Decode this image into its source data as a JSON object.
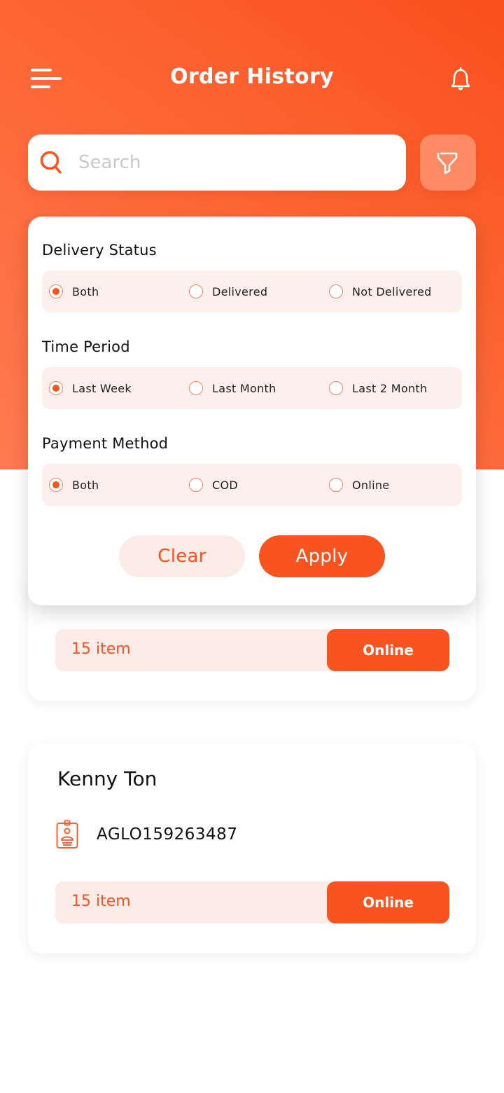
{
  "header": {
    "title": "Order History",
    "menu_icon": "hamburger-menu-icon",
    "notification_icon": "bell-icon"
  },
  "search": {
    "placeholder": "Search",
    "value": "",
    "icon": "search-icon",
    "filter_icon": "filter-funnel-icon"
  },
  "filter_panel": {
    "sections": [
      {
        "title": "Delivery Status",
        "options": [
          {
            "label": "Both",
            "selected": true
          },
          {
            "label": "Delivered",
            "selected": false
          },
          {
            "label": "Not Delivered",
            "selected": false
          }
        ]
      },
      {
        "title": "Time Period",
        "options": [
          {
            "label": "Last Week",
            "selected": true
          },
          {
            "label": "Last Month",
            "selected": false
          },
          {
            "label": "Last 2 Month",
            "selected": false
          }
        ]
      },
      {
        "title": "Payment Method",
        "options": [
          {
            "label": "Both",
            "selected": true
          },
          {
            "label": "COD",
            "selected": false
          },
          {
            "label": "Online",
            "selected": false
          }
        ]
      }
    ],
    "clear_label": "Clear",
    "apply_label": "Apply"
  },
  "orders": [
    {
      "customer": "",
      "order_id": "",
      "items": "15 item",
      "payment": "Online"
    },
    {
      "customer": "Kenny Ton",
      "order_id": "AGLO159263487",
      "id_icon": "id-badge-icon",
      "items": "15 item",
      "payment": "Online"
    }
  ],
  "colors": {
    "accent": "#f95420",
    "accent_light": "#ff8a66",
    "tint": "#fdf0ec"
  }
}
